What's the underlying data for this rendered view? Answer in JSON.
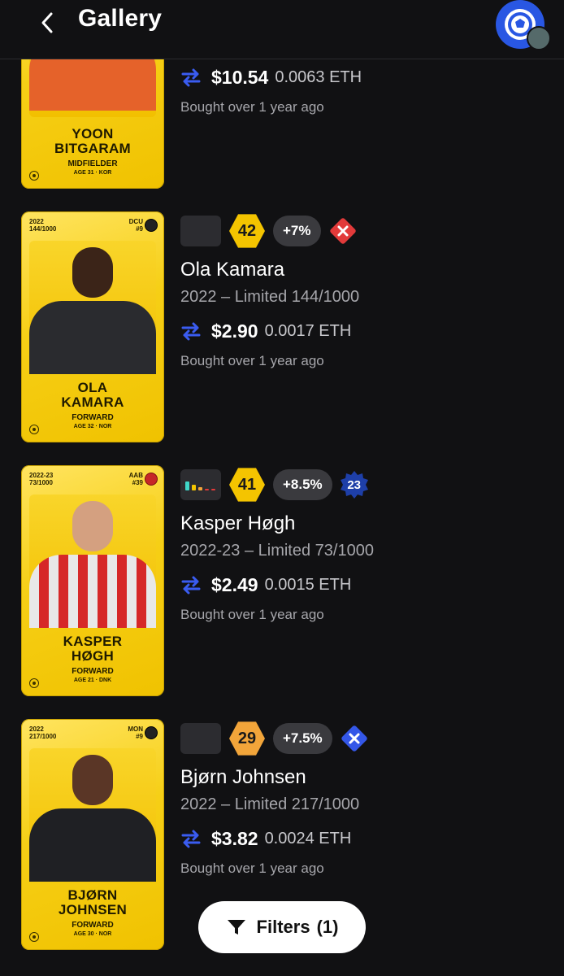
{
  "header": {
    "title": "Gallery"
  },
  "items": [
    {
      "card": {
        "first": "YOON",
        "last": "BITGARAM",
        "position": "MIDFIELDER",
        "age": "AGE 31 · KOR",
        "season": "",
        "serial": "",
        "club_code": ""
      },
      "price_usd": "$10.54",
      "price_eth": "0.0063 ETH",
      "bought": "Bought over 1 year ago"
    },
    {
      "card": {
        "first": "OLA",
        "last": "KAMARA",
        "position": "FORWARD",
        "age": "AGE 32 · NOR",
        "season": "2022",
        "serial": "144/1000",
        "club_code": "DCU",
        "club_num": "#9"
      },
      "score": "42",
      "score_color": "#f4c400",
      "change": "+7%",
      "name": "Ola Kamara",
      "edition": "2022 – Limited 144/1000",
      "price_usd": "$2.90",
      "price_eth": "0.0017 ETH",
      "bought": "Bought over 1 year ago",
      "status": "red-x"
    },
    {
      "card": {
        "first": "KASPER",
        "last": "HØGH",
        "position": "FORWARD",
        "age": "AGE 21 · DNK",
        "season": "2022-23",
        "serial": "73/1000",
        "club_code": "AAB",
        "club_num": "#39"
      },
      "score": "41",
      "score_color": "#f4c400",
      "change": "+8.5%",
      "games": "23",
      "name": "Kasper Høgh",
      "edition": "2022-23 – Limited 73/1000",
      "price_usd": "$2.49",
      "price_eth": "0.0015 ETH",
      "bought": "Bought over 1 year ago",
      "status": "blue-badge"
    },
    {
      "card": {
        "first": "BJØRN",
        "last": "JOHNSEN",
        "position": "FORWARD",
        "age": "AGE 30 · NOR",
        "season": "2022",
        "serial": "217/1000",
        "club_code": "MON",
        "club_num": "#9"
      },
      "score": "29",
      "score_color": "#f2a53a",
      "change": "+7.5%",
      "name": "Bjørn Johnsen",
      "edition": "2022 – Limited 217/1000",
      "price_usd": "$3.82",
      "price_eth": "0.0024 ETH",
      "bought": "Bought over 1 year ago",
      "status": "blue-x"
    }
  ],
  "filters": {
    "label": "Filters",
    "count": "(1)"
  },
  "colors": {
    "background": "#111113",
    "swap_icon": "#3a5cf0",
    "card_gold": "#f6cf16"
  }
}
